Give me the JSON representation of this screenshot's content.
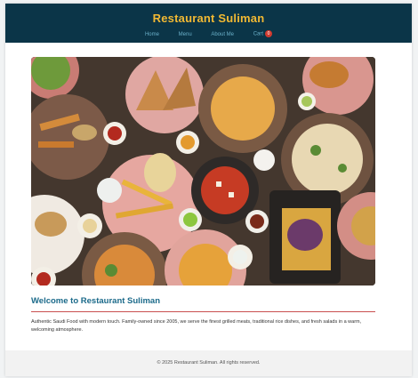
{
  "header": {
    "title": "Restaurant Suliman",
    "nav": {
      "home": "Home",
      "menu": "Menu",
      "about": "About Me",
      "cart": "Cart",
      "cart_count": "0"
    }
  },
  "hero": {
    "image_alt": "Saudi food spread"
  },
  "welcome": {
    "title": "Welcome to Restaurant Suliman",
    "description": "Authentic Saudi Food with modern touch. Family-owned since 2005, we serve the finest grilled meats, traditional rice dishes, and fresh salads in a warm, welcoming atmosphere."
  },
  "footer": {
    "copyright": "© 2025 Restaurant Suliman. All rights reserved."
  },
  "colors": {
    "header_bg": "#0b3548",
    "title_gold": "#f2b933",
    "nav_link": "#6ab0c9",
    "accent_red": "#c94f4f",
    "welcome_blue": "#1b6a8a"
  }
}
